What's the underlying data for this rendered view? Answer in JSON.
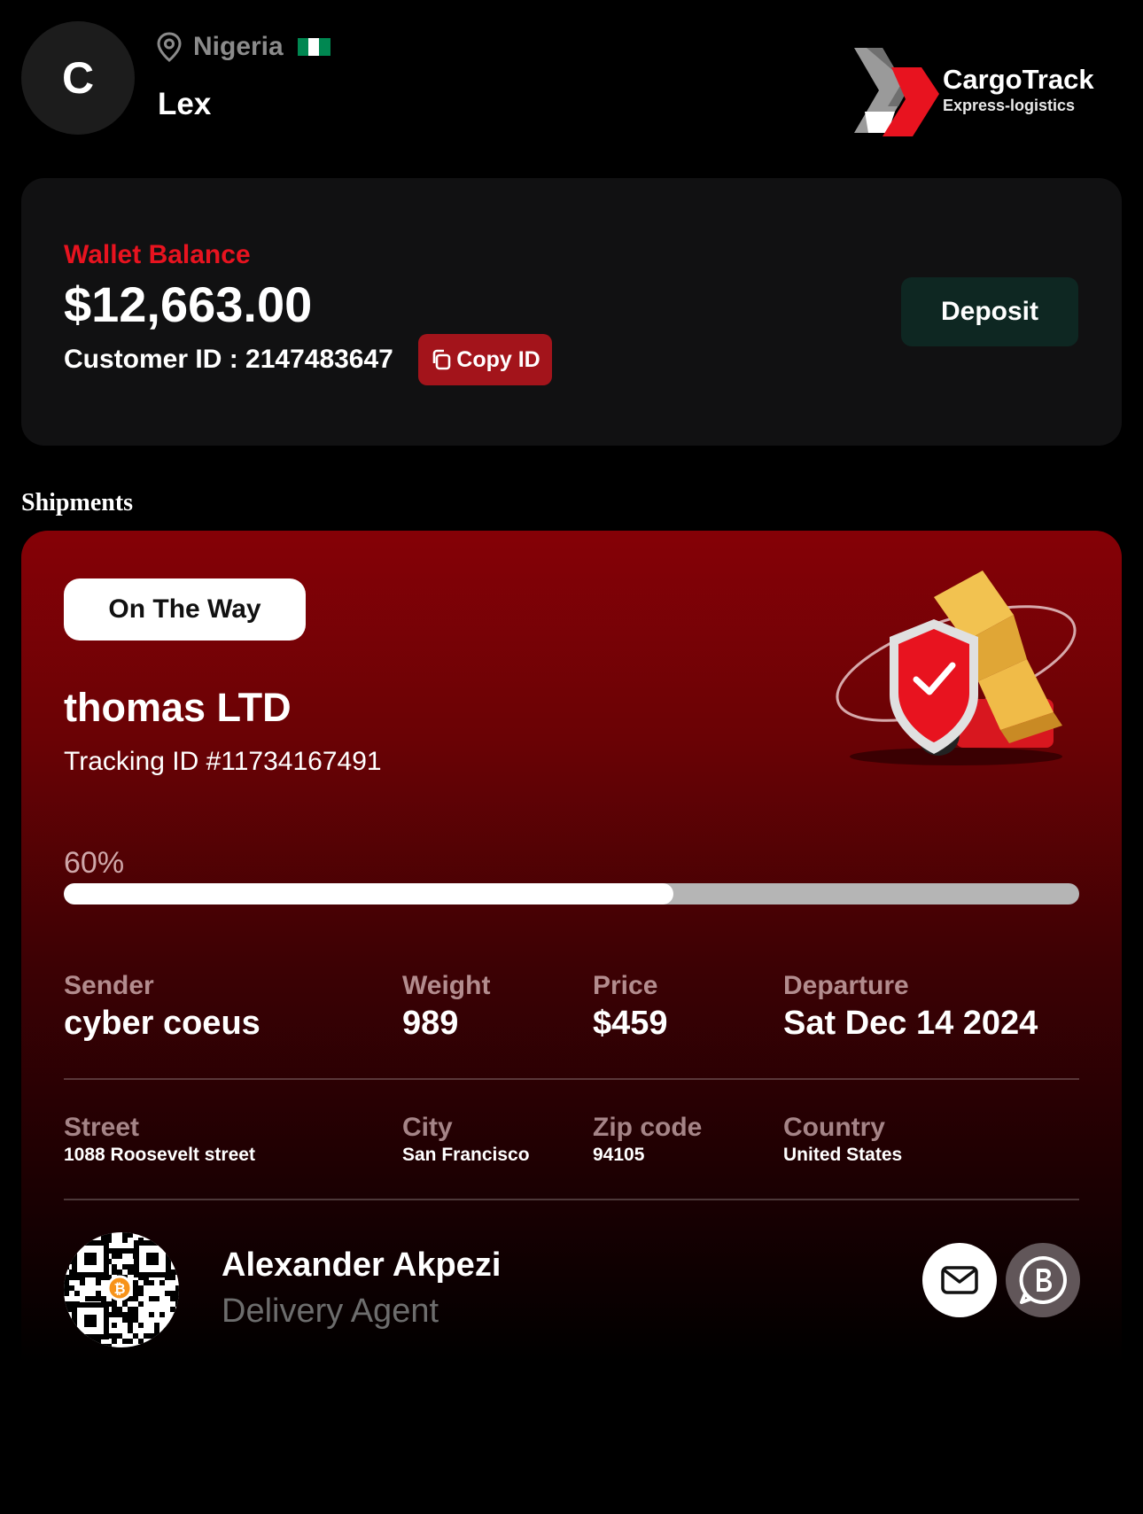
{
  "header": {
    "avatar_initial": "C",
    "location": "Nigeria",
    "flag_colors": [
      "#008751",
      "#ffffff",
      "#008751"
    ],
    "username": "Lex",
    "brand_name": "CargoTrack",
    "brand_tagline": "Express-logistics"
  },
  "wallet": {
    "label": "Wallet Balance",
    "balance": "$12,663.00",
    "customer_id": "Customer ID : 2147483647",
    "copy_label": "Copy ID",
    "deposit_label": "Deposit"
  },
  "shipments_title": "Shipments",
  "shipment": {
    "status": "On The Way",
    "company": "thomas LTD",
    "tracking": "Tracking ID #11734167491",
    "progress_label": "60%",
    "progress_value": 0.6,
    "details": [
      {
        "label": "Sender",
        "value": "cyber coeus"
      },
      {
        "label": "Weight",
        "value": "989"
      },
      {
        "label": "Price",
        "value": "$459"
      },
      {
        "label": "Departure",
        "value": "Sat Dec 14 2024"
      }
    ],
    "address": [
      {
        "label": "Street",
        "value": "1088 Roosevelt street"
      },
      {
        "label": "City",
        "value": "San Francisco"
      },
      {
        "label": "Zip code",
        "value": "94105"
      },
      {
        "label": "Country",
        "value": "United States"
      }
    ],
    "agent_name": "Alexander Akpezi",
    "agent_role": "Delivery Agent"
  },
  "colors": {
    "accent_red": "#e8131f",
    "copy_button": "#a3141b",
    "deposit_button": "#0e2722"
  },
  "icons": [
    "location-pin-icon",
    "copy-icon",
    "mail-icon",
    "whatsapp-business-icon",
    "bitcoin-icon"
  ]
}
